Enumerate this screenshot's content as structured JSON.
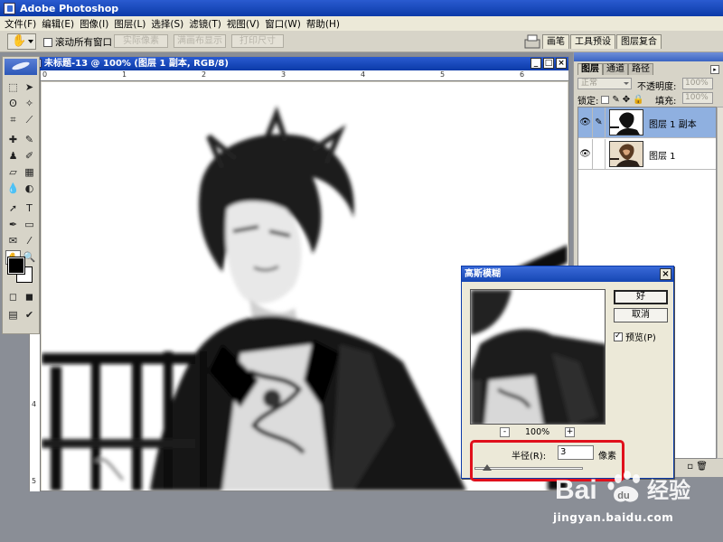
{
  "app": {
    "title": "Adobe Photoshop"
  },
  "menu": [
    "文件(F)",
    "编辑(E)",
    "图像(I)",
    "图层(L)",
    "选择(S)",
    "滤镜(T)",
    "视图(V)",
    "窗口(W)",
    "帮助(H)"
  ],
  "options_bar": {
    "scroll_all_label": "滚动所有窗口",
    "actual_pixels_label": "实际像素",
    "fit_screen_label": "满画布显示",
    "print_size_label": "打印尺寸"
  },
  "palette_well_tabs": [
    "画笔",
    "工具预设",
    "图层复合"
  ],
  "document": {
    "title": "未标题-13 @ 100% (图层 1 副本, RGB/8)",
    "ruler_h_labels": [
      "0",
      "1",
      "2",
      "3",
      "4",
      "5",
      "6",
      "7",
      "8"
    ],
    "ruler_v_labels": [
      "4",
      "5"
    ]
  },
  "layers_panel": {
    "tabs": [
      "图层",
      "通道",
      "路径"
    ],
    "blend_mode": "正常",
    "opacity_label": "不透明度:",
    "opacity_value": "100%",
    "lock_label": "锁定:",
    "fill_label": "填充:",
    "fill_value": "100%",
    "layers": [
      {
        "name": "图层 1 副本",
        "selected": true
      },
      {
        "name": "图层 1",
        "selected": false
      }
    ]
  },
  "gaussian_blur_dialog": {
    "title": "高斯模糊",
    "ok_label": "好",
    "cancel_label": "取消",
    "preview_label": "预览(P)",
    "preview_checked": true,
    "zoom_minus": "-",
    "zoom_plus": "+",
    "zoom_value": "100%",
    "radius_label": "半径(R):",
    "radius_value": "3",
    "radius_unit": "像素",
    "slider_fraction": 0.12
  },
  "watermark": {
    "brand": "Bai du 经验",
    "url": "jingyan.baidu.com"
  }
}
